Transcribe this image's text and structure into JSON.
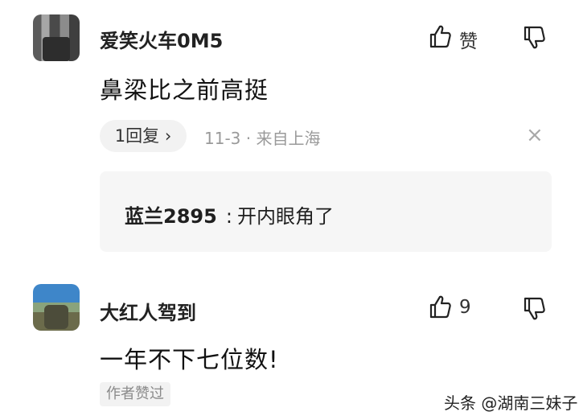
{
  "comments": [
    {
      "username": "爱笑火车0M5",
      "text": "鼻梁比之前高挺",
      "like_label": "赞",
      "reply_pill": "1回复 ›",
      "meta": "11-3 · 来自上海",
      "close": "×",
      "reply": {
        "author": "蓝兰2895",
        "separator": ":",
        "text": "开内眼角了"
      }
    },
    {
      "username": "大红人驾到",
      "text": "一年不下七位数!",
      "like_count": "9",
      "badge": "作者赞过"
    }
  ],
  "watermark": "头条 @湖南三妹子"
}
